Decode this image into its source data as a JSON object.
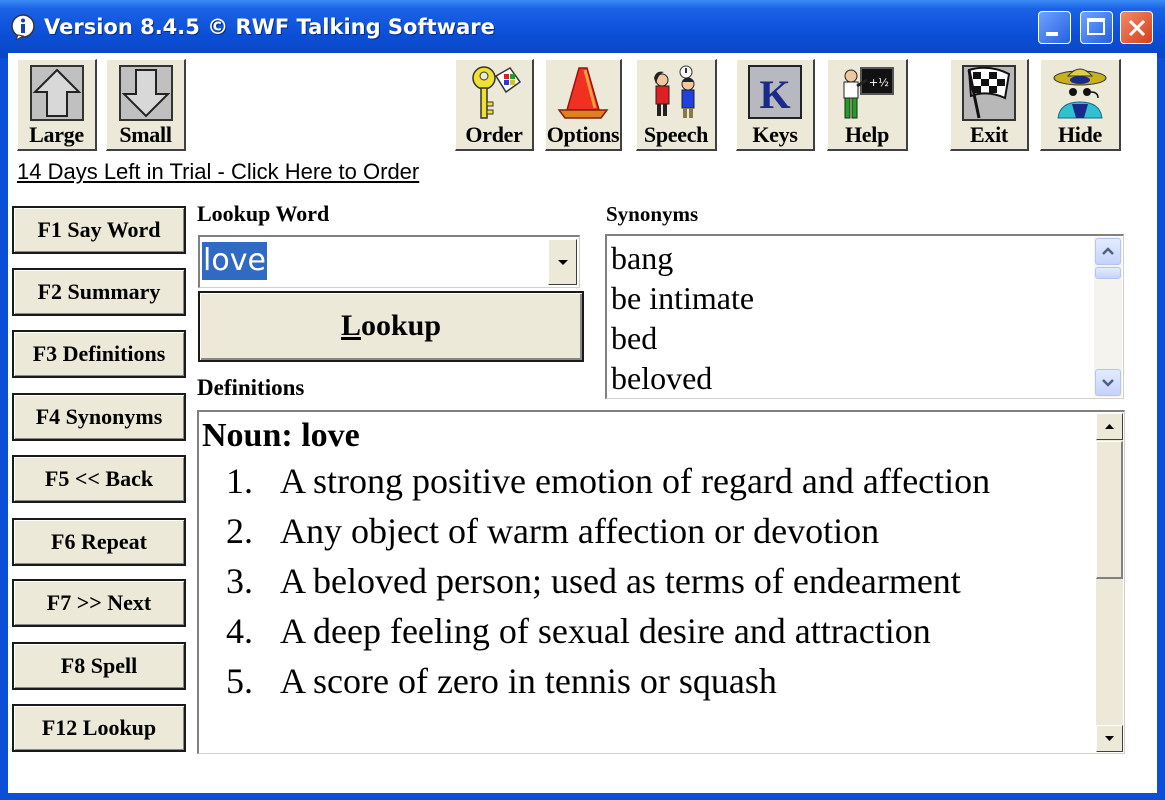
{
  "window": {
    "title": "Version 8.4.5 © RWF Talking Software",
    "controls": [
      "minimize",
      "maximize",
      "close"
    ]
  },
  "toolbar": {
    "buttons": [
      {
        "id": "large",
        "label": "Large",
        "icon": "arrow-up-icon"
      },
      {
        "id": "small",
        "label": "Small",
        "icon": "arrow-down-icon"
      },
      {
        "id": "order",
        "label": "Order",
        "icon": "key-icon"
      },
      {
        "id": "options",
        "label": "Options",
        "icon": "traffic-cone-icon"
      },
      {
        "id": "speech",
        "label": "Speech",
        "icon": "people-talking-icon"
      },
      {
        "id": "keys",
        "label": "Keys",
        "icon": "k-key-icon"
      },
      {
        "id": "help",
        "label": "Help",
        "icon": "teacher-blackboard-icon"
      },
      {
        "id": "exit",
        "label": "Exit",
        "icon": "checkered-flag-icon"
      },
      {
        "id": "hide",
        "label": "Hide",
        "icon": "hat-sunglasses-icon"
      }
    ]
  },
  "trial_link": "14 Days Left in Trial - Click Here to Order",
  "function_keys": [
    "F1 Say Word",
    "F2 Summary",
    "F3 Definitions",
    "F4 Synonyms",
    "F5 << Back",
    "F6 Repeat",
    "F7 >> Next",
    "F8 Spell",
    "F12 Lookup"
  ],
  "lookup": {
    "label": "Lookup Word",
    "value": "love",
    "button_label_accel": "L",
    "button_label_rest": "ookup"
  },
  "synonyms": {
    "label": "Synonyms",
    "items": [
      "bang",
      "be intimate",
      "bed",
      "beloved"
    ]
  },
  "definitions": {
    "label": "Definitions",
    "heading": "Noun: love",
    "items": [
      {
        "num": "1.",
        "text": "A strong positive emotion of regard and affection"
      },
      {
        "num": "2.",
        "text": "Any object of warm affection or devotion"
      },
      {
        "num": "3.",
        "text": "A beloved person; used as terms of endearment"
      },
      {
        "num": "4.",
        "text": "A deep feeling of sexual desire and attraction"
      },
      {
        "num": "5.",
        "text": "A score of zero in tennis or squash"
      }
    ]
  }
}
